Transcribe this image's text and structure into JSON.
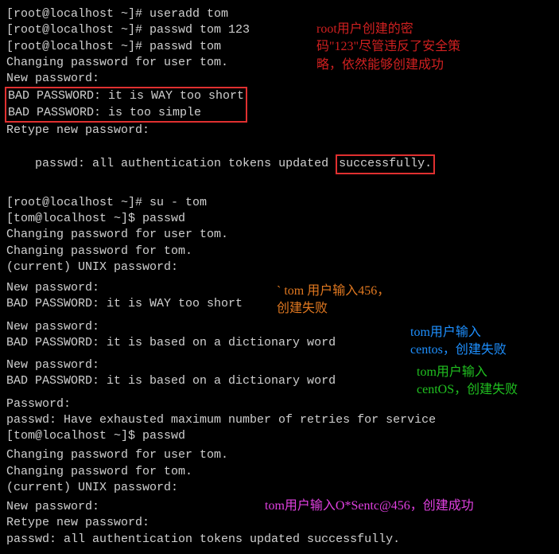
{
  "block1": {
    "l1": "[root@localhost ~]# useradd tom",
    "l2": "[root@localhost ~]# passwd tom 123",
    "l3": "[root@localhost ~]# passwd tom",
    "l4": "Changing password for user tom.",
    "l5": "New password:",
    "l6": "BAD PASSWORD: it is WAY too short",
    "l7": "BAD PASSWORD: is too simple",
    "l8": "Retype new password:",
    "l9a": "passwd: all authentication tokens updated ",
    "l9b": "successfully."
  },
  "block2": {
    "l1": "[root@localhost ~]# su - tom",
    "l2": "[tom@localhost ~]$ passwd",
    "l3": "Changing password for user tom.",
    "l4": "Changing password for tom.",
    "l5": "(current) UNIX password:",
    "l6": "New password:",
    "l7": "BAD PASSWORD: it is WAY too short",
    "l8": "New password:",
    "l9": "BAD PASSWORD: it is based on a dictionary word",
    "l10": "New password:",
    "l11": "BAD PASSWORD: it is based on a dictionary word",
    "l12": "Password:",
    "l13": "passwd: Have exhausted maximum number of retries for service",
    "l14": "[tom@localhost ~]$ passwd",
    "l15": "Changing password for user tom.",
    "l16": "Changing password for tom.",
    "l17": "(current) UNIX password:",
    "l18": "New password:",
    "l19": "Retype new password:",
    "l20": "passwd: all authentication tokens updated successfully."
  },
  "annot": {
    "a1": "root用户创建的密码\"123\"尽管违反了安全策略，依然能够创建成功",
    "a2a": "tom 用户输入456，",
    "a2b": "创建失败",
    "a3a": "tom用户输入",
    "a3b": "centos，创建失败",
    "a4a": "tom用户输入",
    "a4b": "centOS，创建失败",
    "a5": "tom用户输入O*Sentc@456，创建成功"
  }
}
